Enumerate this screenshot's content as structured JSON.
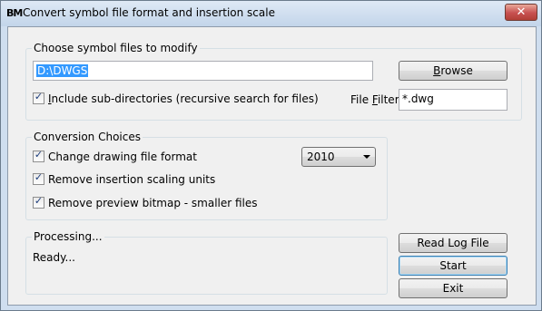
{
  "window": {
    "icon_text": "BM",
    "title": "Convert symbol file format and insertion scale",
    "close_glyph": "✕"
  },
  "symbol_files": {
    "group_title": "Choose symbol files to modify",
    "path_value": "D:\\DWGS",
    "browse_label_u": "B",
    "browse_label_rest": "rowse",
    "include_subdirs_label_u": "I",
    "include_subdirs_label_rest": "nclude sub-directories (recursive search for files)",
    "include_subdirs_checked": true,
    "file_filter_label_pre": "File ",
    "file_filter_label_u": "F",
    "file_filter_label_rest": "ilter",
    "file_filter_value": "*.dwg"
  },
  "conversion": {
    "group_title": "Conversion Choices",
    "change_format_label": "Change drawing file format",
    "change_format_checked": true,
    "format_selected": "2010",
    "remove_scaling_label": "Remove insertion scaling units",
    "remove_scaling_checked": true,
    "remove_preview_label": "Remove preview bitmap - smaller files",
    "remove_preview_checked": true
  },
  "processing": {
    "group_title": "Processing...",
    "status_text": "Ready..."
  },
  "actions": {
    "read_log_label": "Read Log File",
    "start_label": "Start",
    "exit_label": "Exit"
  },
  "check_glyph": "✓",
  "colors": {
    "title_bar": "#c9d9ec",
    "close_button": "#c75050",
    "selection": "#3399ff",
    "dialog_bg": "#f0f0f0"
  }
}
